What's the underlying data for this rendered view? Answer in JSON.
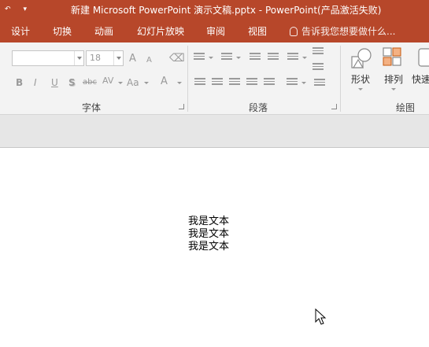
{
  "window": {
    "title": "新建 Microsoft PowerPoint 演示文稿.pptx - PowerPoint(产品激活失败)",
    "qat_undo": "↶",
    "qat_more": "▾"
  },
  "tabs": [
    "设计",
    "切换",
    "动画",
    "幻灯片放映",
    "审阅",
    "视图"
  ],
  "tell_me": "告诉我您想要做什么...",
  "ribbon": {
    "font_group": {
      "label": "字体",
      "font_name": "",
      "font_size": "18",
      "grow": "A",
      "shrink": "A",
      "bold": "B",
      "italic": "I",
      "underline": "U",
      "shadow": "S",
      "strike": "abc",
      "spacing": "AV",
      "case": "Aa",
      "color": "A"
    },
    "paragraph_group": {
      "label": "段落"
    },
    "drawing_group": {
      "label": "绘图",
      "shape_label": "形状",
      "arrange_label": "排列",
      "quick_label": "快速"
    }
  },
  "slide": {
    "lines": [
      "我是文本",
      "我是文本",
      "我是文本"
    ]
  }
}
